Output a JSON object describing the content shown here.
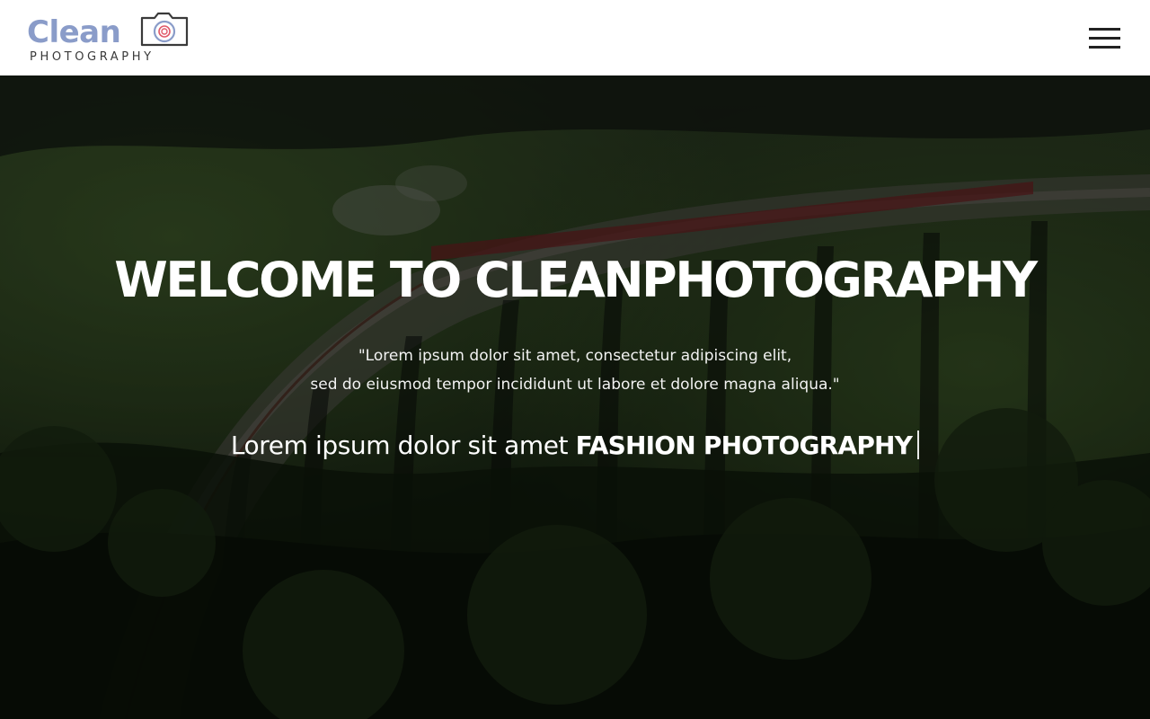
{
  "header": {
    "logo": {
      "word": "Clean",
      "sub": "PHOTOGRAPHY",
      "word_color": "#8a9cc9",
      "sub_color": "#3a3a3a",
      "camera_icon": "camera-icon",
      "lens_accent_color": "#e05a6a"
    },
    "menu_icon": "hamburger-menu-icon"
  },
  "hero": {
    "background": "photo of steam train crossing stone viaduct through green hills, darkened overlay",
    "title": "WELCOME TO CLEANPHOTOGRAPHY",
    "quote_line_1": "\"Lorem ipsum dolor sit amet, consectetur adipiscing elit,",
    "quote_line_2": "sed do eiusmod tempor incididunt ut labore et dolore magna aliqua.\"",
    "tagline_prefix": "Lorem ipsum dolor sit amet",
    "tagline_highlight": "FASHION PHOTOGRAPHY"
  }
}
